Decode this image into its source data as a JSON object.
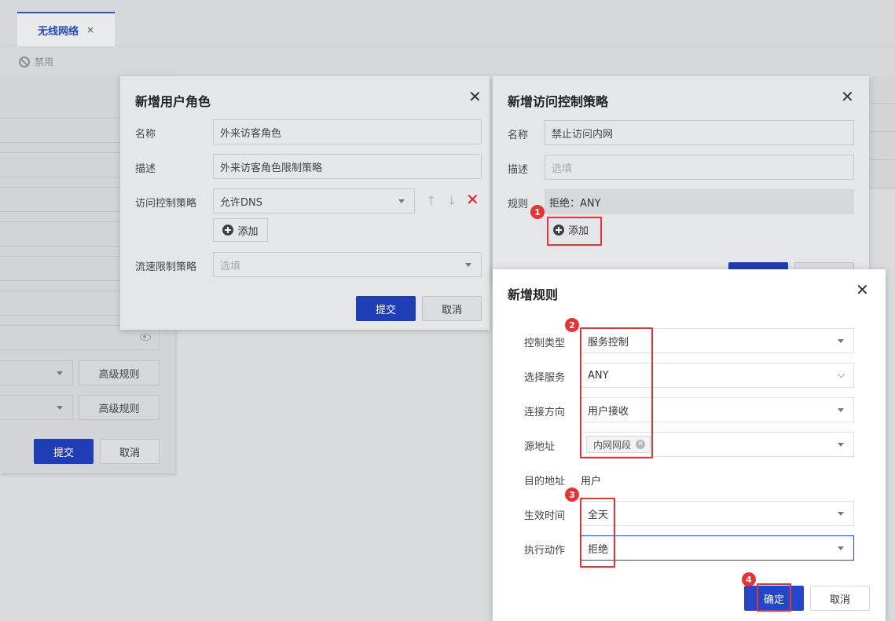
{
  "tabs": {
    "active_label": "无线网络",
    "close_glyph": "×"
  },
  "toolbar": {
    "disable_label": "禁用"
  },
  "base_panel": {
    "advanced_rule_label": "高级规则",
    "submit_label": "提交",
    "cancel_label": "取消"
  },
  "role_dialog": {
    "title": "新增用户角色",
    "close_glyph": "✕",
    "name_label": "名称",
    "name_value": "外来访客角色",
    "desc_label": "描述",
    "desc_value": "外来访客角色限制策略",
    "acl_label": "访问控制策略",
    "acl_value": "允许DNS",
    "add_label": "添加",
    "rate_label": "流速限制策略",
    "rate_placeholder": "选填",
    "submit_label": "提交",
    "cancel_label": "取消"
  },
  "acl_dialog": {
    "title": "新增访问控制策略",
    "close_glyph": "✕",
    "name_label": "名称",
    "name_value": "禁止访问内网",
    "desc_label": "描述",
    "desc_placeholder": "选填",
    "rule_label": "规则",
    "rule_value": "拒绝：ANY",
    "add_label": "添加"
  },
  "rule_dialog": {
    "title": "新增规则",
    "close_glyph": "✕",
    "control_type_label": "控制类型",
    "control_type_value": "服务控制",
    "service_label": "选择服务",
    "service_value": "ANY",
    "direction_label": "连接方向",
    "direction_value": "用户接收",
    "source_label": "源地址",
    "source_tag": "内网网段",
    "dest_label": "目的地址",
    "dest_value": "用户",
    "time_label": "生效时间",
    "time_value": "全天",
    "action_label": "执行动作",
    "action_value": "拒绝",
    "confirm_label": "确定",
    "cancel_label": "取消"
  },
  "annotations": {
    "step1": "1",
    "step2": "2",
    "step3": "3",
    "step4": "4",
    "color": "#e23535"
  },
  "colors": {
    "primary": "#2446c9",
    "danger": "#e02020"
  },
  "icons": [
    "ban-icon",
    "eye-icon",
    "plus-circle-icon",
    "arrow-up-icon",
    "arrow-down-icon",
    "delete-icon",
    "close-icon",
    "caret-down-icon",
    "chevron-down-icon"
  ]
}
